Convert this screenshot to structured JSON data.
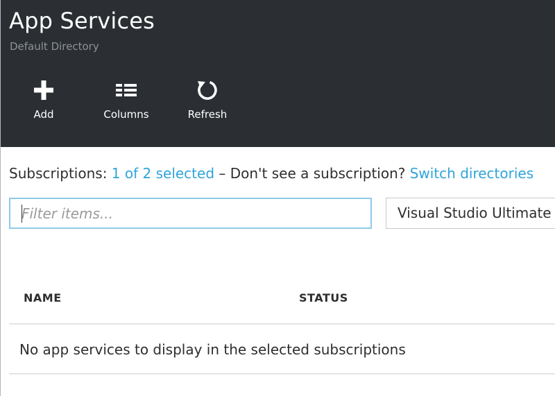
{
  "blade": {
    "title": "App Services",
    "subtitle": "Default Directory"
  },
  "toolbar": {
    "add_label": "Add",
    "columns_label": "Columns",
    "refresh_label": "Refresh"
  },
  "subscriptions": {
    "label": "Subscriptions:",
    "selected_link": "1 of 2 selected",
    "separator": "– Don't see a subscription?",
    "switch_link": "Switch directories"
  },
  "filter": {
    "placeholder": "Filter items...",
    "value": ""
  },
  "subscription_dropdown": {
    "selected": "Visual Studio Ultimate"
  },
  "table": {
    "columns": [
      "NAME",
      "STATUS"
    ],
    "empty_message": "No app services to display in the selected subscriptions"
  },
  "colors": {
    "header_bg": "#2b2f33",
    "link": "#2fa4d9",
    "input_focus_border": "#8ccbe8"
  }
}
